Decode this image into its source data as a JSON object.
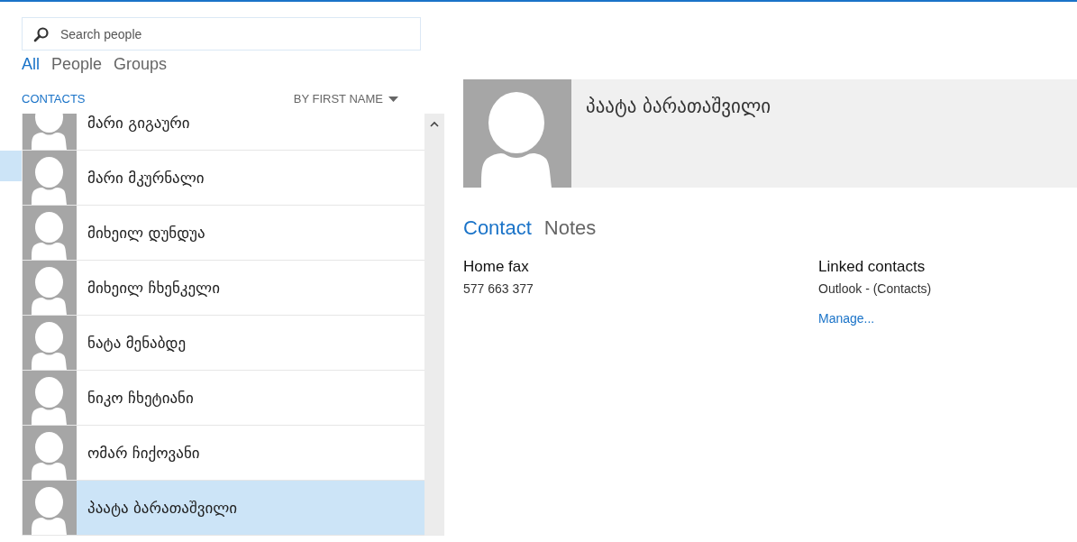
{
  "search": {
    "placeholder": "Search people"
  },
  "filters": [
    {
      "label": "All",
      "selected": true
    },
    {
      "label": "People",
      "selected": false
    },
    {
      "label": "Groups",
      "selected": false
    }
  ],
  "list_header": {
    "title": "CONTACTS",
    "sort": "BY FIRST NAME"
  },
  "contacts": [
    {
      "name": "მარი გიგაური",
      "selected": false
    },
    {
      "name": "მარი მკურნალი",
      "selected": false
    },
    {
      "name": "მიხეილ დუნდუა",
      "selected": false
    },
    {
      "name": "მიხეილ ჩხენკელი",
      "selected": false
    },
    {
      "name": "ნატა მენაბდე",
      "selected": false
    },
    {
      "name": "ნიკო ჩხეტიანი",
      "selected": false
    },
    {
      "name": "ომარ ჩიქოვანი",
      "selected": false
    },
    {
      "name": "პაატა ბარათაშვილი",
      "selected": true
    }
  ],
  "detail": {
    "name": "პაატა ბარათაშვილი",
    "tabs": [
      {
        "label": "Contact",
        "selected": true
      },
      {
        "label": "Notes",
        "selected": false
      }
    ],
    "fields": [
      {
        "label": "Home fax",
        "value": "577 663 377"
      }
    ],
    "linked": {
      "label": "Linked contacts",
      "value": "Outlook - (Contacts)",
      "link": "Manage..."
    }
  }
}
